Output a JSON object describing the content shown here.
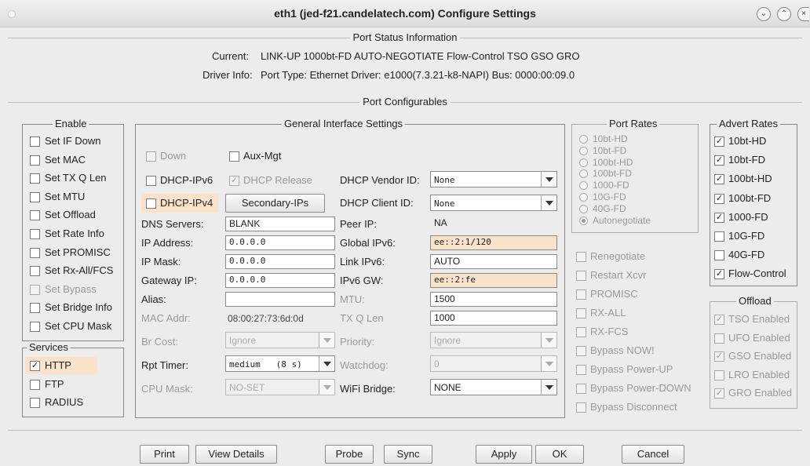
{
  "window": {
    "title": "eth1  (jed-f21.candelatech.com) Configure Settings"
  },
  "status": {
    "section_title": "Port Status Information",
    "current_label": "Current:",
    "current_value": "LINK-UP 1000bt-FD AUTO-NEGOTIATE Flow-Control TSO GSO GRO",
    "driver_label": "Driver Info:",
    "driver_value": "Port Type: Ethernet  Driver: e1000(7.3.21-k8-NAPI)  Bus: 0000:00:09.0"
  },
  "configurables_title": "Port Configurables",
  "enable": {
    "title": "Enable",
    "items": [
      {
        "label": "Set IF Down",
        "checked": false,
        "disabled": false
      },
      {
        "label": "Set MAC",
        "checked": false,
        "disabled": false
      },
      {
        "label": "Set TX Q Len",
        "checked": false,
        "disabled": false
      },
      {
        "label": "Set MTU",
        "checked": false,
        "disabled": false
      },
      {
        "label": "Set Offload",
        "checked": false,
        "disabled": false
      },
      {
        "label": "Set Rate Info",
        "checked": false,
        "disabled": false
      },
      {
        "label": "Set PROMISC",
        "checked": false,
        "disabled": false
      },
      {
        "label": "Set Rx-All/FCS",
        "checked": false,
        "disabled": false
      },
      {
        "label": "Set Bypass",
        "checked": false,
        "disabled": true
      },
      {
        "label": "Set Bridge Info",
        "checked": false,
        "disabled": false
      },
      {
        "label": "Set CPU Mask",
        "checked": false,
        "disabled": false
      }
    ]
  },
  "services": {
    "title": "Services",
    "items": [
      {
        "label": "HTTP",
        "checked": true
      },
      {
        "label": "FTP",
        "checked": false
      },
      {
        "label": "RADIUS",
        "checked": false
      }
    ]
  },
  "general": {
    "title": "General Interface Settings",
    "down": "Down",
    "aux_mgt": "Aux-Mgt",
    "dhcp_ipv6": "DHCP-IPv6",
    "dhcp_release": "DHCP Release",
    "dhcp_ipv4": "DHCP-IPv4",
    "secondary_ips": "Secondary-IPs",
    "dhcp_vendor_label": "DHCP Vendor ID:",
    "dhcp_vendor_value": "None",
    "dhcp_client_label": "DHCP Client ID:",
    "dhcp_client_value": "None",
    "dns_label": "DNS Servers:",
    "dns_value": "BLANK",
    "peer_label": "Peer IP:",
    "peer_value": "NA",
    "ip_label": "IP Address:",
    "ip_value": "0.0.0.0",
    "global_ipv6_label": "Global IPv6:",
    "global_ipv6_value": "ee::2:1/120",
    "mask_label": "IP Mask:",
    "mask_value": "0.0.0.0",
    "link_ipv6_label": "Link IPv6:",
    "link_ipv6_value": "AUTO",
    "gw_label": "Gateway IP:",
    "gw_value": "0.0.0.0",
    "ipv6gw_label": "IPv6 GW:",
    "ipv6gw_value": "ee::2:fe",
    "alias_label": "Alias:",
    "alias_value": "",
    "mtu_label": "MTU:",
    "mtu_value": "1500",
    "mac_label": "MAC Addr:",
    "mac_value": "08:00:27:73:6d:0d",
    "txq_label": "TX Q Len",
    "txq_value": "1000",
    "brcost_label": "Br Cost:",
    "brcost_value": "Ignore",
    "priority_label": "Priority:",
    "priority_value": "Ignore",
    "rpt_label": "Rpt Timer:",
    "rpt_value": "medium   (8 s)",
    "watchdog_label": "Watchdog:",
    "watchdog_value": "0",
    "cpumask_label": "CPU Mask:",
    "cpumask_value": "NO-SET",
    "wifibridge_label": "WiFi Bridge:",
    "wifibridge_value": "NONE"
  },
  "port_rates": {
    "title": "Port Rates",
    "items": [
      "10bt-HD",
      "10bt-FD",
      "100bt-HD",
      "100bt-FD",
      "1000-FD",
      "10G-FD",
      "40G-FD",
      "Autonegotiate"
    ],
    "selected": "Autonegotiate"
  },
  "misc": {
    "items": [
      "Renegotiate",
      "Restart Xcvr",
      "PROMISC",
      "RX-ALL",
      "RX-FCS",
      "Bypass NOW!",
      "Bypass Power-UP",
      "Bypass Power-DOWN",
      "Bypass Disconnect"
    ]
  },
  "advert": {
    "title": "Advert Rates",
    "items": [
      {
        "label": "10bt-HD",
        "checked": true
      },
      {
        "label": "10bt-FD",
        "checked": true
      },
      {
        "label": "100bt-HD",
        "checked": true
      },
      {
        "label": "100bt-FD",
        "checked": true
      },
      {
        "label": "1000-FD",
        "checked": true
      },
      {
        "label": "10G-FD",
        "checked": false
      },
      {
        "label": "40G-FD",
        "checked": false
      },
      {
        "label": "Flow-Control",
        "checked": true
      }
    ]
  },
  "offload": {
    "title": "Offload",
    "items": [
      {
        "label": "TSO Enabled",
        "checked": true
      },
      {
        "label": "UFO Enabled",
        "checked": false
      },
      {
        "label": "GSO Enabled",
        "checked": true
      },
      {
        "label": "LRO Enabled",
        "checked": false
      },
      {
        "label": "GRO Enabled",
        "checked": true
      }
    ]
  },
  "buttons": {
    "print": "Print",
    "view_details": "View Details",
    "probe": "Probe",
    "sync": "Sync",
    "apply": "Apply",
    "ok": "OK",
    "cancel": "Cancel"
  },
  "icons": {
    "check": "check-icon",
    "minimize": "chevron-down-icon",
    "maximize": "chevron-up-icon",
    "close": "close-icon"
  }
}
